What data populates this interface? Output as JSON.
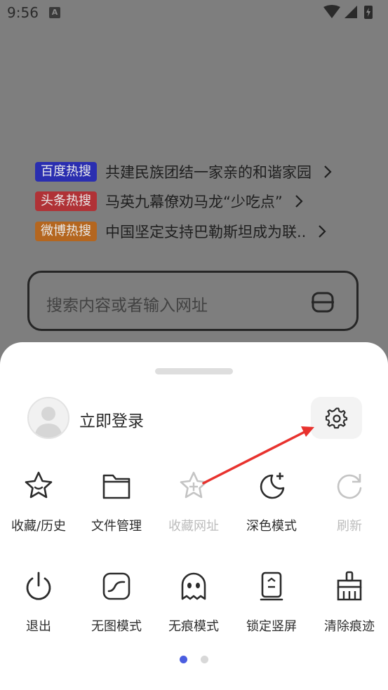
{
  "status_bar": {
    "time": "9:56",
    "notification_icon_letter": "A"
  },
  "hot_search": [
    {
      "badge": "百度热搜",
      "badge_color": "#2a2eb0",
      "text": "共建民族团结一家亲的和谐家园"
    },
    {
      "badge": "头条热搜",
      "badge_color": "#b03236",
      "text": "马英九幕僚劝马龙“少吃点”"
    },
    {
      "badge": "微博热搜",
      "badge_color": "#b4661f",
      "text": "中国坚定支持巴勒斯坦成为联.."
    }
  ],
  "search": {
    "placeholder": "搜索内容或者输入网址"
  },
  "sheet": {
    "login_label": "立即登录",
    "row1": [
      {
        "label": "收藏/历史",
        "icon": "star-icon",
        "enabled": true
      },
      {
        "label": "文件管理",
        "icon": "folder-icon",
        "enabled": true
      },
      {
        "label": "收藏网址",
        "icon": "star-plus-icon",
        "enabled": false
      },
      {
        "label": "深色模式",
        "icon": "moon-plus-icon",
        "enabled": true
      },
      {
        "label": "刷新",
        "icon": "refresh-icon",
        "enabled": false
      }
    ],
    "row2": [
      {
        "label": "退出",
        "icon": "power-icon",
        "enabled": true
      },
      {
        "label": "无图模式",
        "icon": "no-image-icon",
        "enabled": true
      },
      {
        "label": "无痕模式",
        "icon": "ghost-icon",
        "enabled": true
      },
      {
        "label": "锁定竖屏",
        "icon": "portrait-lock-icon",
        "enabled": true
      },
      {
        "label": "清除痕迹",
        "icon": "broom-icon",
        "enabled": true
      }
    ],
    "page_indicator": {
      "current": 1,
      "total": 2,
      "active_color": "#4a5de0",
      "inactive_color": "#d8d8d8"
    }
  },
  "annotation_color": "#e8322e"
}
